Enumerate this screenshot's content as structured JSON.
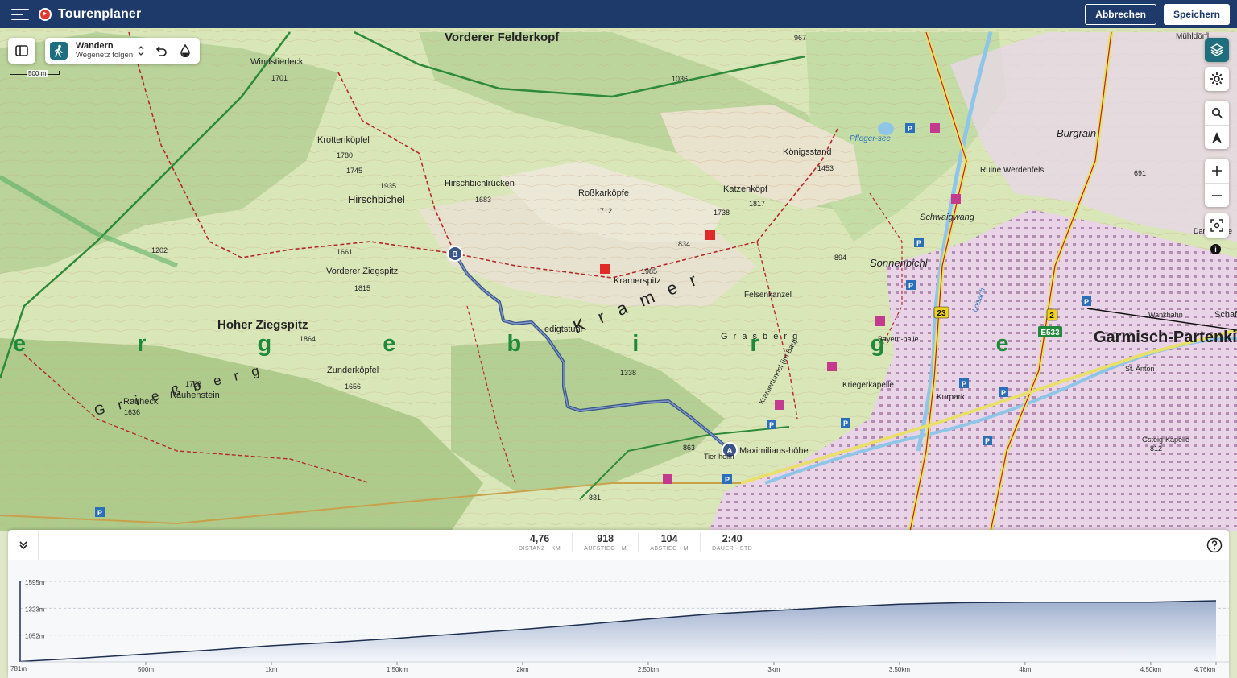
{
  "header": {
    "title": "Tourenplaner",
    "cancel_label": "Abbrechen",
    "save_label": "Speichern"
  },
  "route_mode": {
    "activity": "Wandern",
    "routing": "Wegenetz folgen"
  },
  "map": {
    "scale_label": "500 m",
    "labels": {
      "vorderer_felderkopf": "Vorderer Felderkopf",
      "windstierleck": "Windstierleck",
      "windstierleck_h": "1701",
      "krottenkoepfel": "Krottenköpfel",
      "krottenkoepfel_h": "1780",
      "h1745": "1745",
      "h1935": "1935",
      "hirschbichel": "Hirschbichel",
      "hirschbichlruecken": "Hirschbichlrücken",
      "h1683": "1683",
      "rosskarkoepfe": "Roßkarköpfe",
      "h1712": "1712",
      "katzenkoepf": "Katzenköpf",
      "h1738": "1738",
      "h1817": "1817",
      "koenigsstand": "Königsstand",
      "h1453": "1453",
      "pflegersee": "Pfleger-see",
      "burgrain": "Burgrain",
      "ruine": "Ruine Werdenfels",
      "schwaigwang": "Schwaigwang",
      "sonnenbichl": "Sonnenbichl",
      "h1036": "1036",
      "h967": "967",
      "h691": "691",
      "h1202": "1202",
      "h1661": "1661",
      "vorderer_ziegspitz": "Vorderer Ziegspitz",
      "h1815": "1815",
      "hoher_ziegspitz": "Hoher Ziegspitz",
      "h1864": "1864",
      "h1834": "1834",
      "kramerspitz": "Kramerspitz",
      "h1985": "1985",
      "felsenkanzel": "Felsenkanzel",
      "h894": "894",
      "kramer": "K r a m e r",
      "stuhl": "edigtstuhl",
      "grasberg": "G r a s b e r g",
      "kramertunnel": "Kramertunnel (im Bau)",
      "griessberg": "G r i e ß b e r g",
      "rauheck": "Rauheck",
      "h1636": "1636",
      "h1728": "1728",
      "rauhenstein": "Rauhenstein",
      "zunderkoepfel": "Zunderköpfel",
      "h1656": "1656",
      "h1338": "1338",
      "gebirge": "e r g e b i r g e",
      "h863": "863",
      "h831": "831",
      "tierheim": "Tier-heim",
      "maximilianshoehe": "Maximilians-höhe",
      "bayernhalle": "Bayern-halle",
      "kriegerkapelle": "Kriegerkapelle",
      "kurpark": "Kurpark",
      "gap": "Garmisch-Partenkirchen",
      "st_anton": "St. Anton",
      "gsteig": "Gsteig-Kapelle",
      "h812": "812",
      "wankbahn": "Wankbahn",
      "schaf": "Schaf",
      "mueh": "Mühldörfl",
      "dan": "Dan-kapelle",
      "e533": "E533",
      "r23": "23",
      "r2": "2",
      "loisach": "Loisach",
      "marker_a": "A",
      "marker_b": "B"
    }
  },
  "stats": [
    {
      "value": "4,76",
      "label": "DISTANZ · KM"
    },
    {
      "value": "918",
      "label": "AUFSTIEG · M"
    },
    {
      "value": "104",
      "label": "ABSTIEG · M"
    },
    {
      "value": "2:40",
      "label": "DAUER · STD"
    }
  ],
  "chart_data": {
    "type": "area",
    "title": "",
    "xlabel": "",
    "ylabel": "",
    "ylim": [
      781,
      1595
    ],
    "xlim": [
      0,
      4.76
    ],
    "y_ticks": [
      {
        "value": 781,
        "label": "781m"
      },
      {
        "value": 1052,
        "label": "1052m"
      },
      {
        "value": 1323,
        "label": "1323m"
      },
      {
        "value": 1595,
        "label": "1595m"
      }
    ],
    "x_ticks": [
      {
        "value": 0.5,
        "label": "500m"
      },
      {
        "value": 1.0,
        "label": "1km"
      },
      {
        "value": 1.5,
        "label": "1,50km"
      },
      {
        "value": 2.0,
        "label": "2km"
      },
      {
        "value": 2.5,
        "label": "2,50km"
      },
      {
        "value": 3.0,
        "label": "3km"
      },
      {
        "value": 3.5,
        "label": "3,50km"
      },
      {
        "value": 4.0,
        "label": "4km"
      },
      {
        "value": 4.5,
        "label": "4,50km"
      },
      {
        "value": 4.76,
        "label": "4,76km"
      }
    ],
    "x": [
      0,
      0.25,
      0.5,
      0.75,
      1.0,
      1.25,
      1.5,
      1.75,
      2.0,
      2.25,
      2.5,
      2.75,
      3.0,
      3.25,
      3.5,
      3.75,
      4.0,
      4.25,
      4.5,
      4.76
    ],
    "series": [
      {
        "values": [
          785,
          820,
          860,
          900,
          945,
          980,
          1020,
          1065,
          1110,
          1160,
          1215,
          1265,
          1300,
          1335,
          1365,
          1380,
          1385,
          1385,
          1385,
          1400
        ]
      }
    ],
    "grid": true
  }
}
